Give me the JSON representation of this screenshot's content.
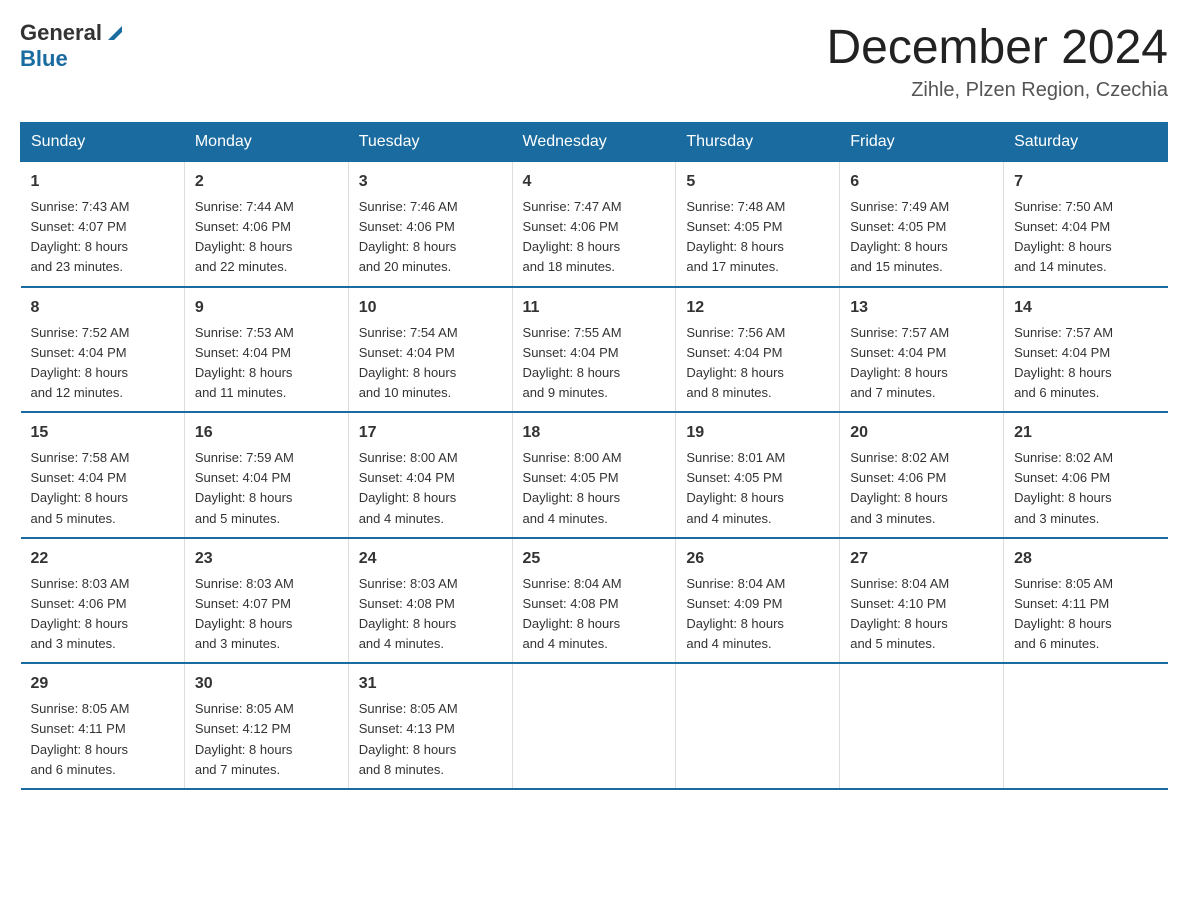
{
  "header": {
    "logo_general": "General",
    "logo_blue": "Blue",
    "title": "December 2024",
    "subtitle": "Zihle, Plzen Region, Czechia"
  },
  "days_of_week": [
    "Sunday",
    "Monday",
    "Tuesday",
    "Wednesday",
    "Thursday",
    "Friday",
    "Saturday"
  ],
  "weeks": [
    [
      {
        "day": "1",
        "sunrise": "7:43 AM",
        "sunset": "4:07 PM",
        "daylight": "8 hours and 23 minutes."
      },
      {
        "day": "2",
        "sunrise": "7:44 AM",
        "sunset": "4:06 PM",
        "daylight": "8 hours and 22 minutes."
      },
      {
        "day": "3",
        "sunrise": "7:46 AM",
        "sunset": "4:06 PM",
        "daylight": "8 hours and 20 minutes."
      },
      {
        "day": "4",
        "sunrise": "7:47 AM",
        "sunset": "4:06 PM",
        "daylight": "8 hours and 18 minutes."
      },
      {
        "day": "5",
        "sunrise": "7:48 AM",
        "sunset": "4:05 PM",
        "daylight": "8 hours and 17 minutes."
      },
      {
        "day": "6",
        "sunrise": "7:49 AM",
        "sunset": "4:05 PM",
        "daylight": "8 hours and 15 minutes."
      },
      {
        "day": "7",
        "sunrise": "7:50 AM",
        "sunset": "4:04 PM",
        "daylight": "8 hours and 14 minutes."
      }
    ],
    [
      {
        "day": "8",
        "sunrise": "7:52 AM",
        "sunset": "4:04 PM",
        "daylight": "8 hours and 12 minutes."
      },
      {
        "day": "9",
        "sunrise": "7:53 AM",
        "sunset": "4:04 PM",
        "daylight": "8 hours and 11 minutes."
      },
      {
        "day": "10",
        "sunrise": "7:54 AM",
        "sunset": "4:04 PM",
        "daylight": "8 hours and 10 minutes."
      },
      {
        "day": "11",
        "sunrise": "7:55 AM",
        "sunset": "4:04 PM",
        "daylight": "8 hours and 9 minutes."
      },
      {
        "day": "12",
        "sunrise": "7:56 AM",
        "sunset": "4:04 PM",
        "daylight": "8 hours and 8 minutes."
      },
      {
        "day": "13",
        "sunrise": "7:57 AM",
        "sunset": "4:04 PM",
        "daylight": "8 hours and 7 minutes."
      },
      {
        "day": "14",
        "sunrise": "7:57 AM",
        "sunset": "4:04 PM",
        "daylight": "8 hours and 6 minutes."
      }
    ],
    [
      {
        "day": "15",
        "sunrise": "7:58 AM",
        "sunset": "4:04 PM",
        "daylight": "8 hours and 5 minutes."
      },
      {
        "day": "16",
        "sunrise": "7:59 AM",
        "sunset": "4:04 PM",
        "daylight": "8 hours and 5 minutes."
      },
      {
        "day": "17",
        "sunrise": "8:00 AM",
        "sunset": "4:04 PM",
        "daylight": "8 hours and 4 minutes."
      },
      {
        "day": "18",
        "sunrise": "8:00 AM",
        "sunset": "4:05 PM",
        "daylight": "8 hours and 4 minutes."
      },
      {
        "day": "19",
        "sunrise": "8:01 AM",
        "sunset": "4:05 PM",
        "daylight": "8 hours and 4 minutes."
      },
      {
        "day": "20",
        "sunrise": "8:02 AM",
        "sunset": "4:06 PM",
        "daylight": "8 hours and 3 minutes."
      },
      {
        "day": "21",
        "sunrise": "8:02 AM",
        "sunset": "4:06 PM",
        "daylight": "8 hours and 3 minutes."
      }
    ],
    [
      {
        "day": "22",
        "sunrise": "8:03 AM",
        "sunset": "4:06 PM",
        "daylight": "8 hours and 3 minutes."
      },
      {
        "day": "23",
        "sunrise": "8:03 AM",
        "sunset": "4:07 PM",
        "daylight": "8 hours and 3 minutes."
      },
      {
        "day": "24",
        "sunrise": "8:03 AM",
        "sunset": "4:08 PM",
        "daylight": "8 hours and 4 minutes."
      },
      {
        "day": "25",
        "sunrise": "8:04 AM",
        "sunset": "4:08 PM",
        "daylight": "8 hours and 4 minutes."
      },
      {
        "day": "26",
        "sunrise": "8:04 AM",
        "sunset": "4:09 PM",
        "daylight": "8 hours and 4 minutes."
      },
      {
        "day": "27",
        "sunrise": "8:04 AM",
        "sunset": "4:10 PM",
        "daylight": "8 hours and 5 minutes."
      },
      {
        "day": "28",
        "sunrise": "8:05 AM",
        "sunset": "4:11 PM",
        "daylight": "8 hours and 6 minutes."
      }
    ],
    [
      {
        "day": "29",
        "sunrise": "8:05 AM",
        "sunset": "4:11 PM",
        "daylight": "8 hours and 6 minutes."
      },
      {
        "day": "30",
        "sunrise": "8:05 AM",
        "sunset": "4:12 PM",
        "daylight": "8 hours and 7 minutes."
      },
      {
        "day": "31",
        "sunrise": "8:05 AM",
        "sunset": "4:13 PM",
        "daylight": "8 hours and 8 minutes."
      },
      null,
      null,
      null,
      null
    ]
  ],
  "labels": {
    "sunrise": "Sunrise:",
    "sunset": "Sunset:",
    "daylight": "Daylight:"
  }
}
